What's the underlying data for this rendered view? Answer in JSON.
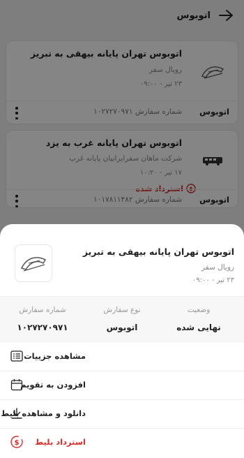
{
  "header": {
    "title": "اتوبوس"
  },
  "orders": [
    {
      "title": "اتوبوس تهران پایانه بیهقی به تبریز",
      "company": "رویال سفر",
      "datetime": "۲۳ تیر - ۰۹:۰۰",
      "type": "اتوبوس",
      "order_number": "شماره سفارش ۱۰۲۷۲۷۰۹۷۱"
    },
    {
      "title": "اتوبوس تهران پایانه غرب به یزد",
      "company": "شرکت ماهان سفرایرانیان پایانه غرب",
      "datetime": "۱۷ تیر - ۱۰:۲۰",
      "status": "استرداد شده",
      "type": "اتوبوس",
      "order_number": "شماره سفارش ۱۰۱۷۸۱۱۴۸۲"
    }
  ],
  "sheet": {
    "title": "اتوبوس تهران پایانه بیهقی به تبریز",
    "company": "رویال سفر",
    "datetime": "۲۳ تیر - ۰۹:۰۰",
    "info": {
      "order_number_label": "شماره سفارش",
      "order_number_value": "۱۰۲۷۲۷۰۹۷۱",
      "order_type_label": "نوع سفارش",
      "order_type_value": "اتوبوس",
      "status_label": "وضعیت",
      "status_value": "نهایی شده"
    },
    "actions": {
      "details": "مشاهده جزییات",
      "calendar": "افزودن به تقویم",
      "download": "دانلود و مشاهده بلیط",
      "refund": "استرداد بلیط"
    }
  },
  "colors": {
    "refund": "#d32f2f",
    "overlay": "rgba(0,0,0,0.48)"
  }
}
